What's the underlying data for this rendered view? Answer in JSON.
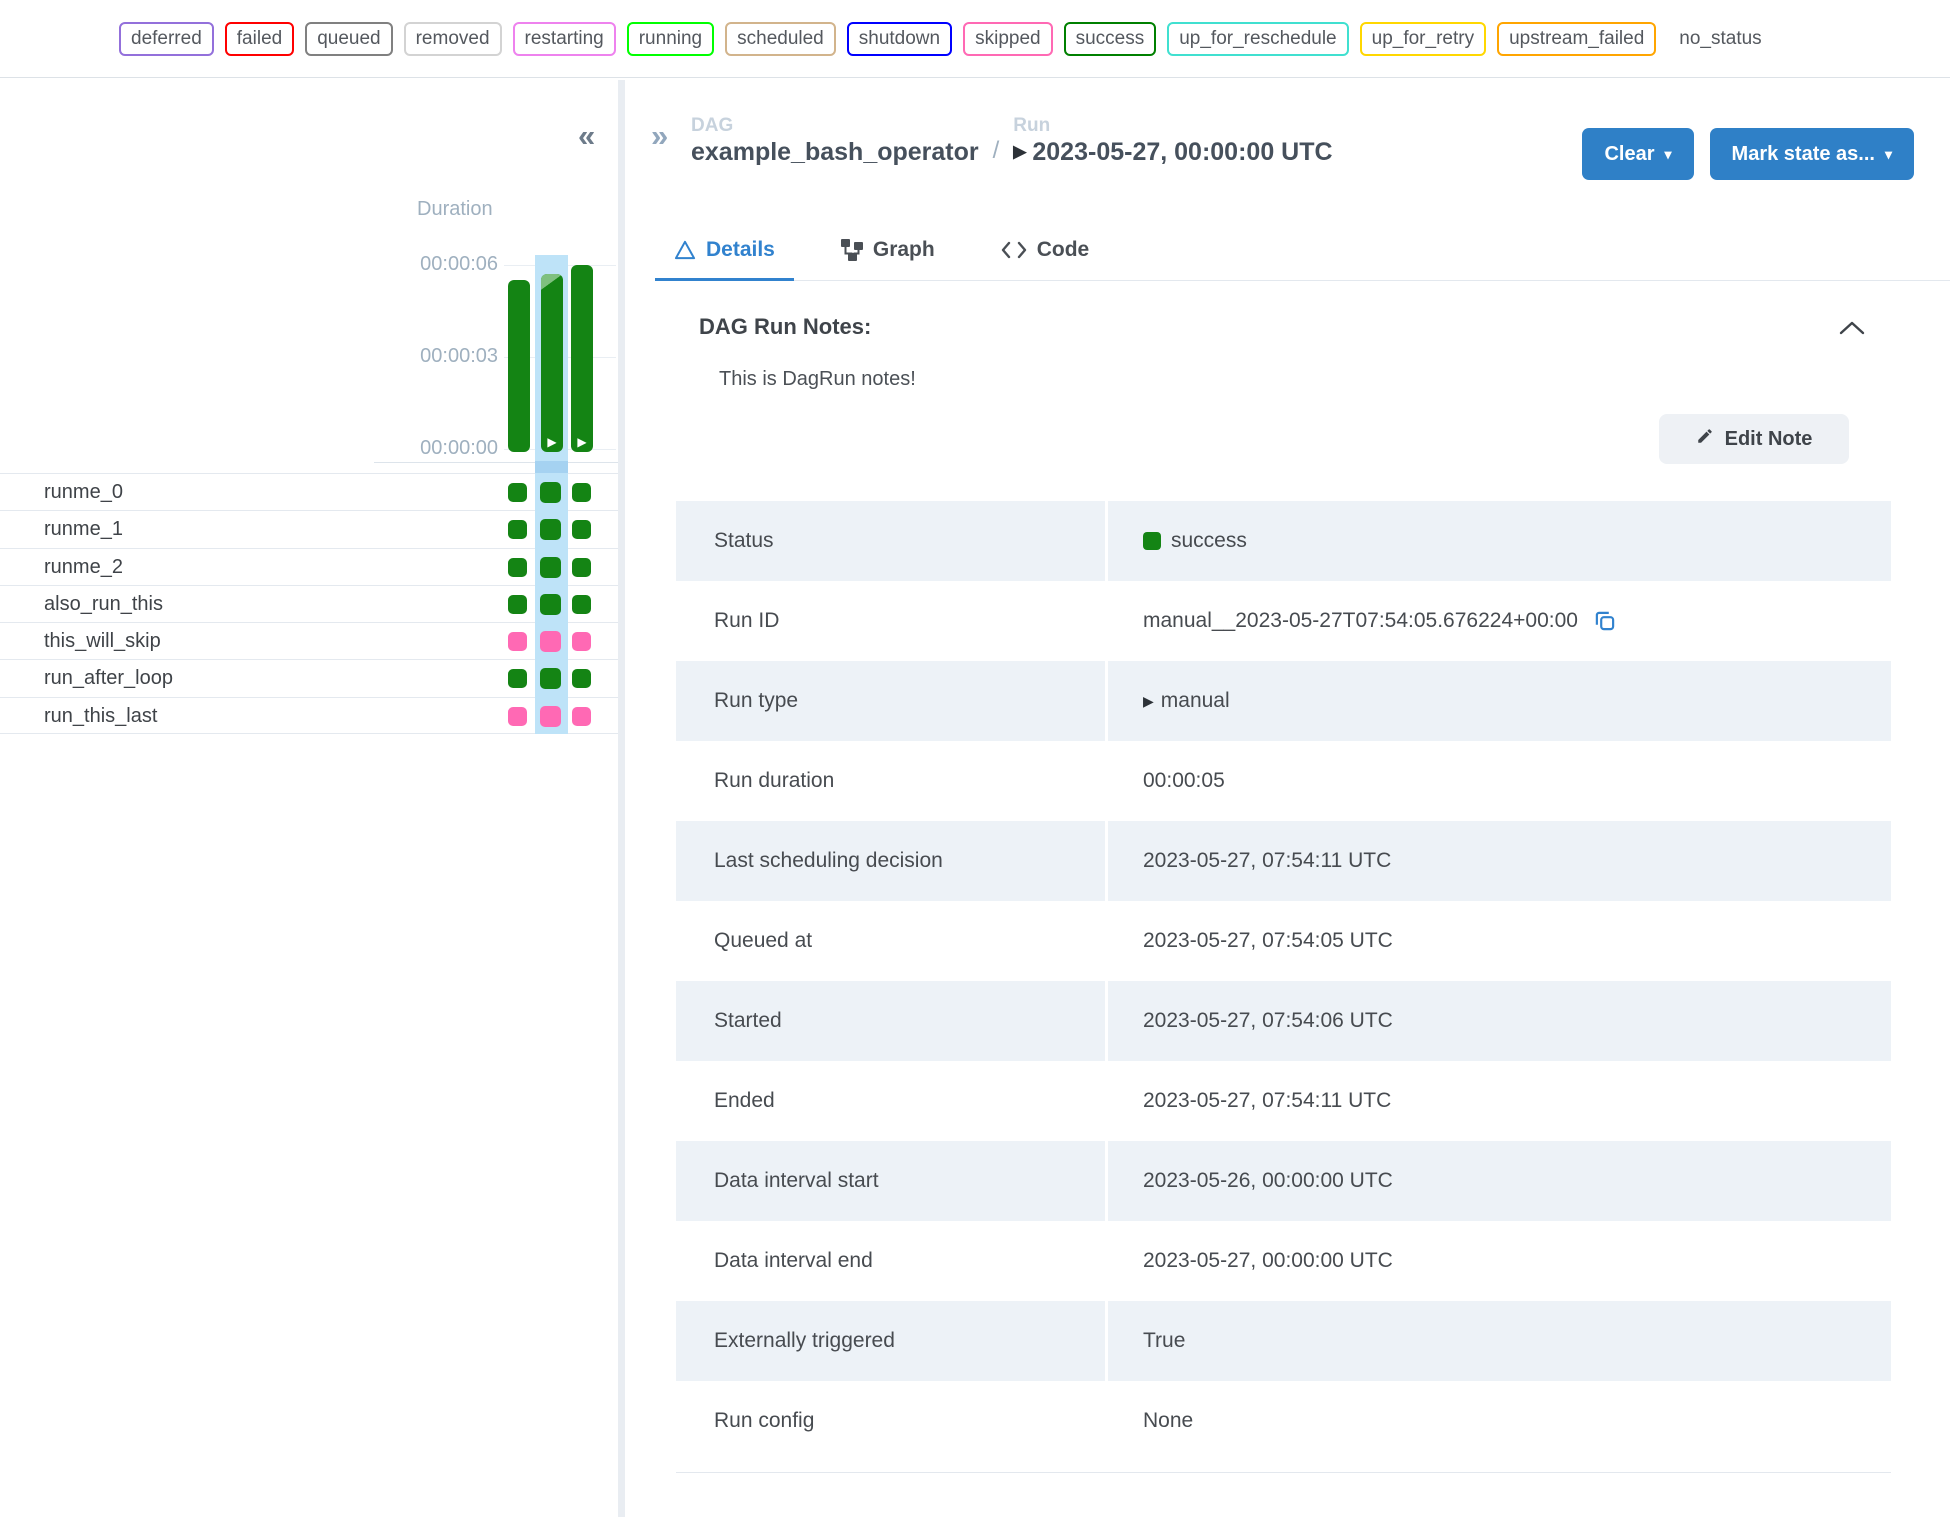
{
  "accent_blue": "#2f80c7",
  "legend": {
    "badges": [
      {
        "label": "deferred",
        "color": "#9370DB"
      },
      {
        "label": "failed",
        "color": "#FF0000"
      },
      {
        "label": "queued",
        "color": "#808080"
      },
      {
        "label": "removed",
        "color": "#D3D3D3"
      },
      {
        "label": "restarting",
        "color": "#EE82EE"
      },
      {
        "label": "running",
        "color": "#00FF00"
      },
      {
        "label": "scheduled",
        "color": "#D2B48C"
      },
      {
        "label": "shutdown",
        "color": "#0000FF"
      },
      {
        "label": "skipped",
        "color": "#FF69B4"
      },
      {
        "label": "success",
        "color": "#008000"
      },
      {
        "label": "up_for_reschedule",
        "color": "#40E0D0"
      },
      {
        "label": "up_for_retry",
        "color": "#FFD700"
      },
      {
        "label": "upstream_failed",
        "color": "#FFA500"
      },
      {
        "label": "no_status",
        "color": "transparent"
      }
    ]
  },
  "grid": {
    "duration_label": "Duration",
    "ticks": [
      "00:00:06",
      "00:00:03",
      "00:00:00"
    ],
    "collapse_glyph": "«",
    "expand_glyph": "»",
    "play_glyph": "▶",
    "bar_color": "#148414",
    "bars": [
      {
        "seconds": 5.6,
        "manual": false,
        "selected": false,
        "has_note": false
      },
      {
        "seconds": 5.8,
        "manual": true,
        "selected": true,
        "has_note": true
      },
      {
        "seconds": 6.1,
        "manual": true,
        "selected": false,
        "has_note": false
      }
    ],
    "tasks": [
      {
        "name": "runme_0",
        "state": "success",
        "color": "#148414"
      },
      {
        "name": "runme_1",
        "state": "success",
        "color": "#148414"
      },
      {
        "name": "runme_2",
        "state": "success",
        "color": "#148414"
      },
      {
        "name": "also_run_this",
        "state": "success",
        "color": "#148414"
      },
      {
        "name": "this_will_skip",
        "state": "skipped",
        "color": "#FF69B4"
      },
      {
        "name": "run_after_loop",
        "state": "success",
        "color": "#148414"
      },
      {
        "name": "run_this_last",
        "state": "skipped",
        "color": "#FF69B4"
      }
    ]
  },
  "header": {
    "dag_label": "DAG",
    "dag_name": "example_bash_operator",
    "separator": "/",
    "run_label": "Run",
    "run_date": "2023-05-27, 00:00:00 UTC",
    "clear_label": "Clear",
    "mark_state_label": "Mark state as...",
    "caret_glyph": "▾"
  },
  "tabs": [
    {
      "label": "Details",
      "icon": "details-triangle-icon",
      "active": true
    },
    {
      "label": "Graph",
      "icon": "graph-nodes-icon",
      "active": false
    },
    {
      "label": "Code",
      "icon": "code-brackets-icon",
      "active": false
    }
  ],
  "notes": {
    "title": "DAG Run Notes:",
    "text": "This is DagRun notes!",
    "edit_button_label": "Edit Note"
  },
  "details": {
    "status_color": "#148414",
    "rows": [
      {
        "label": "Status",
        "value": "success"
      },
      {
        "label": "Run ID",
        "value": "manual__2023-05-27T07:54:05.676224+00:00"
      },
      {
        "label": "Run type",
        "value": "manual"
      },
      {
        "label": "Run duration",
        "value": "00:00:05"
      },
      {
        "label": "Last scheduling decision",
        "value": "2023-05-27, 07:54:11 UTC"
      },
      {
        "label": "Queued at",
        "value": "2023-05-27, 07:54:05 UTC"
      },
      {
        "label": "Started",
        "value": "2023-05-27, 07:54:06 UTC"
      },
      {
        "label": "Ended",
        "value": "2023-05-27, 07:54:11 UTC"
      },
      {
        "label": "Data interval start",
        "value": "2023-05-26, 00:00:00 UTC"
      },
      {
        "label": "Data interval end",
        "value": "2023-05-27, 00:00:00 UTC"
      },
      {
        "label": "Externally triggered",
        "value": "True"
      },
      {
        "label": "Run config",
        "value": "None"
      }
    ]
  }
}
